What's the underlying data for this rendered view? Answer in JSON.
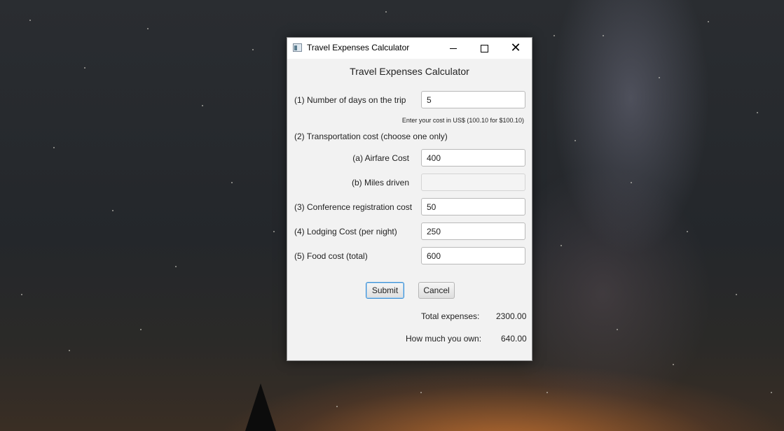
{
  "window": {
    "title": "Travel Expenses Calculator",
    "heading": "Travel Expenses Calculator"
  },
  "form": {
    "days_label": "(1) Number of days on the trip",
    "days_value": "5",
    "hint": "Enter your cost in US$ (100.10 for $100.10)",
    "transport_label": "(2) Transportation cost (choose one only)",
    "airfare_label": "(a) Airfare Cost",
    "airfare_value": "400",
    "miles_label": "(b) Miles driven",
    "miles_value": "",
    "registration_label": "(3) Conference registration cost",
    "registration_value": "50",
    "lodging_label": "(4) Lodging Cost (per night)",
    "lodging_value": "250",
    "food_label": "(5) Food cost (total)",
    "food_value": "600"
  },
  "buttons": {
    "submit": "Submit",
    "cancel": "Cancel"
  },
  "results": {
    "total_label": "Total expenses:",
    "total_value": "2300.00",
    "owe_label": "How much you own:",
    "owe_value": "640.00"
  }
}
